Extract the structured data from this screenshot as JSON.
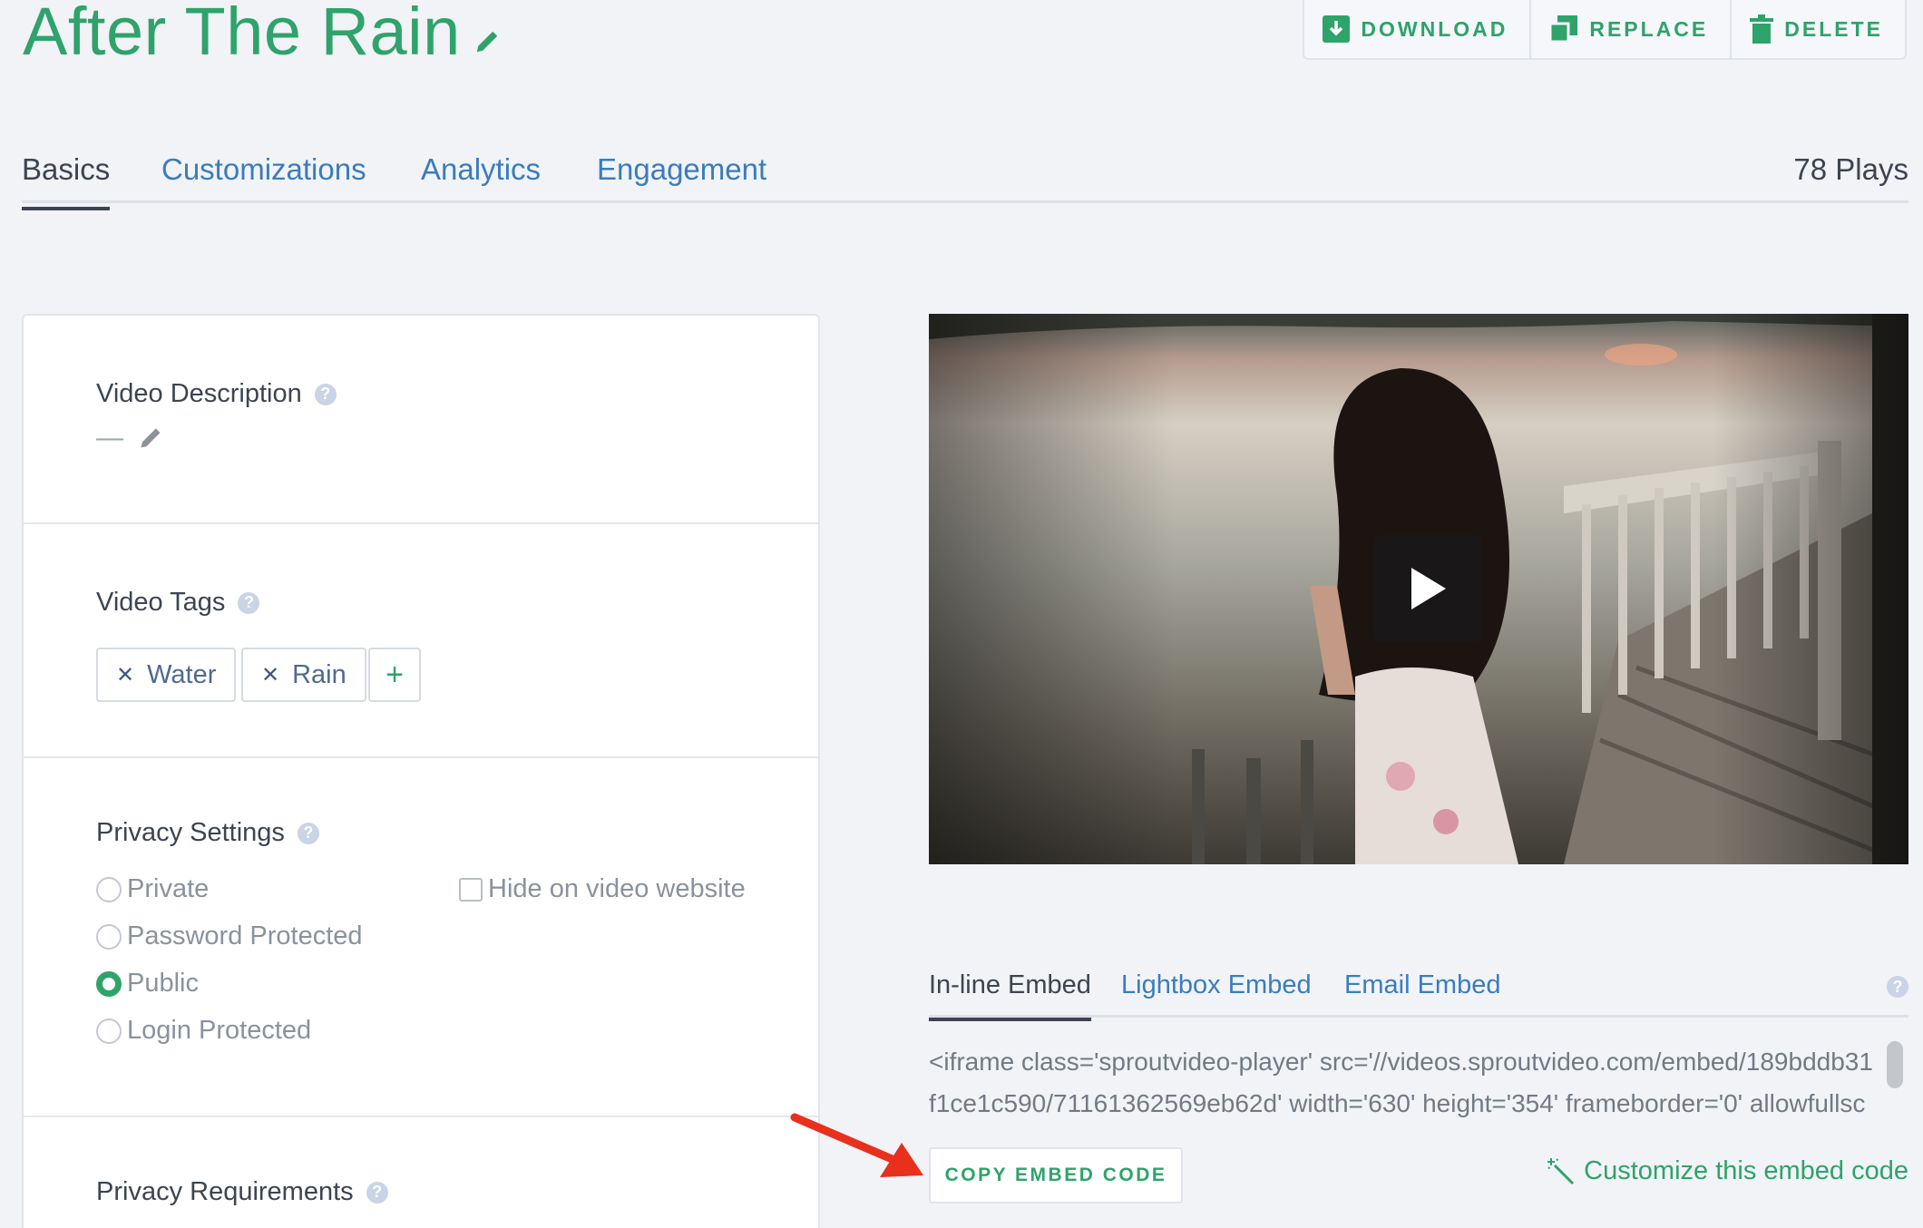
{
  "header": {
    "title": "After The Rain",
    "actions": {
      "download": "DOWNLOAD",
      "replace": "REPLACE",
      "delete": "DELETE"
    }
  },
  "tabs": [
    {
      "label": "Basics",
      "active": true
    },
    {
      "label": "Customizations",
      "active": false
    },
    {
      "label": "Analytics",
      "active": false
    },
    {
      "label": "Engagement",
      "active": false
    }
  ],
  "plays": "78 Plays",
  "description": {
    "label": "Video Description",
    "value": "—"
  },
  "tags": {
    "label": "Video Tags",
    "items": [
      "Water",
      "Rain"
    ],
    "add": "+"
  },
  "privacy": {
    "label": "Privacy Settings",
    "options": [
      "Private",
      "Password Protected",
      "Public",
      "Login Protected"
    ],
    "selected": "Public",
    "hide_label": "Hide on video website"
  },
  "requirements": {
    "label": "Privacy Requirements"
  },
  "embed": {
    "tabs": [
      "In-line Embed",
      "Lightbox Embed",
      "Email Embed"
    ],
    "active_tab": "In-line Embed",
    "code": "<iframe class='sproutvideo-player' src='//videos.sproutvideo.com/embed/189bddb31f1ce1c590/71161362569eb62d' width='630' height='354' frameborder='0' allowfullsc",
    "copy_label": "COPY EMBED CODE",
    "customize_label": "Customize this embed code"
  },
  "colors": {
    "accent": "#2ea36a",
    "link": "#3b7cbd",
    "annotation": "#e8301c"
  }
}
